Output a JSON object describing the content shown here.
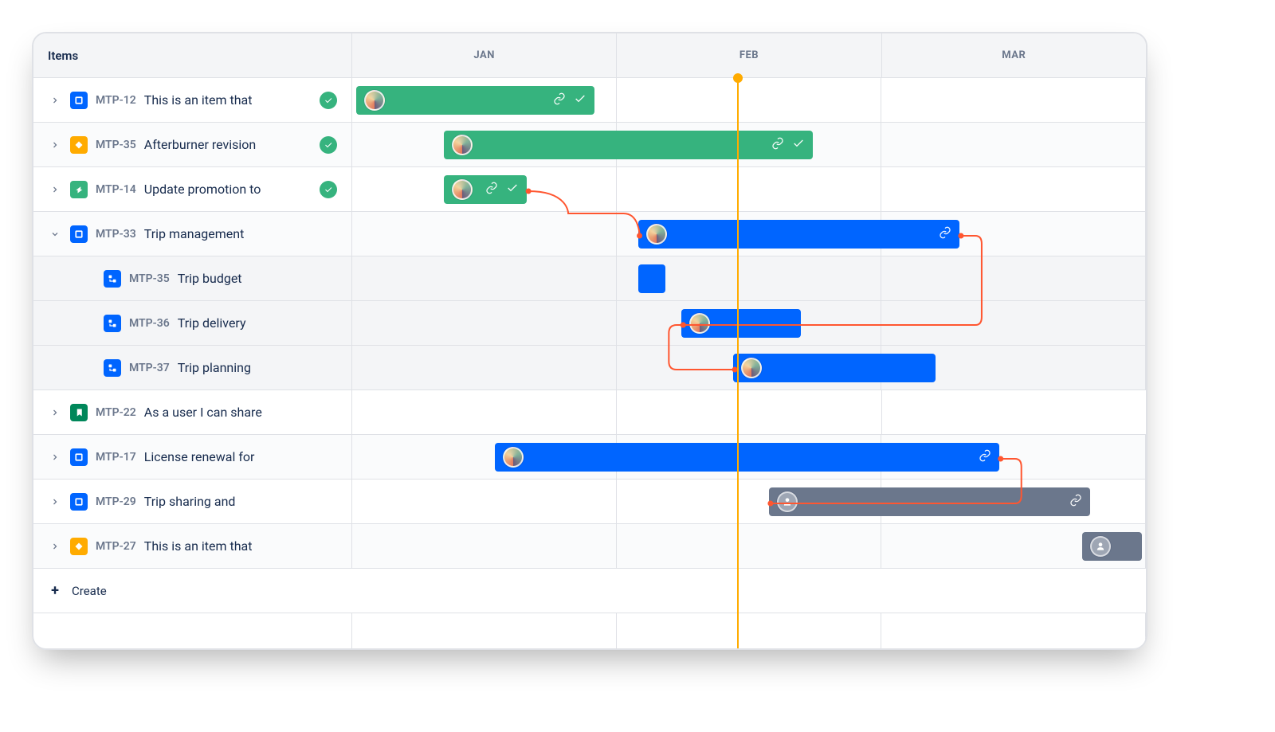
{
  "header": {
    "left": "Items"
  },
  "months": [
    "JAN",
    "FEB",
    "MAR"
  ],
  "create_label": "Create",
  "today_position_pct": 48.5,
  "items": [
    {
      "key": "MTP-12",
      "title": "This is an item that",
      "type": "epic-blue",
      "status": "done",
      "expand": "collapsed",
      "bar": {
        "color": "#36B37E",
        "start": 0.5,
        "end": 30.5,
        "avatar": "person1",
        "icons": [
          "link",
          "check"
        ]
      }
    },
    {
      "key": "MTP-35",
      "title": "Afterburner revision",
      "type": "diamond-orange",
      "status": "done",
      "expand": "collapsed",
      "bar": {
        "color": "#36B37E",
        "start": 11.5,
        "end": 58,
        "avatar": "person2",
        "icons": [
          "link",
          "check"
        ]
      }
    },
    {
      "key": "MTP-14",
      "title": "Update promotion to",
      "type": "action-green",
      "status": "done",
      "expand": "collapsed",
      "bar": {
        "color": "#36B37E",
        "start": 11.5,
        "end": 22,
        "avatar": "person1",
        "icons": [
          "link",
          "check"
        ]
      }
    },
    {
      "key": "MTP-33",
      "title": "Trip management",
      "type": "epic-blue",
      "status": "",
      "expand": "expanded",
      "bar": {
        "color": "#0065ff",
        "start": 36,
        "end": 76.5,
        "avatar": "person3",
        "icons": [
          "link"
        ]
      },
      "children": [
        {
          "key": "MTP-35",
          "title": "Trip budget",
          "type": "child-blue",
          "bar": {
            "color": "#0065ff",
            "start": 36,
            "end": 39.5,
            "avatar": "",
            "icons": []
          }
        },
        {
          "key": "MTP-36",
          "title": "Trip delivery",
          "type": "child-blue",
          "bar": {
            "color": "#0065ff",
            "start": 41.5,
            "end": 56.5,
            "avatar": "person2",
            "icons": []
          }
        },
        {
          "key": "MTP-37",
          "title": "Trip planning",
          "type": "child-blue",
          "bar": {
            "color": "#0065ff",
            "start": 48,
            "end": 73.5,
            "avatar": "person2",
            "icons": []
          }
        }
      ]
    },
    {
      "key": "MTP-22",
      "title": "As a user I can share",
      "type": "bookmark-green",
      "expand": "collapsed",
      "bar": null
    },
    {
      "key": "MTP-17",
      "title": "License renewal for",
      "type": "epic-blue",
      "expand": "collapsed",
      "bar": {
        "color": "#0065ff",
        "start": 18,
        "end": 81.5,
        "avatar": "person3",
        "icons": [
          "link"
        ]
      }
    },
    {
      "key": "MTP-29",
      "title": "Trip sharing and",
      "type": "epic-blue",
      "expand": "collapsed",
      "bar": {
        "color": "#6b778c",
        "start": 52.5,
        "end": 93,
        "avatar": "generic",
        "icons": [
          "link"
        ]
      }
    },
    {
      "key": "MTP-27",
      "title": "This is an item that",
      "type": "diamond-orange",
      "expand": "collapsed",
      "bar": {
        "color": "#6b778c",
        "start": 92,
        "end": 99.5,
        "avatar": "generic",
        "icons": []
      }
    }
  ]
}
